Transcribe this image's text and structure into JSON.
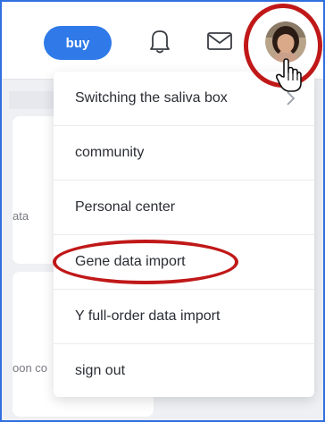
{
  "header": {
    "buy_label": "buy",
    "accent": "#2f7ae8"
  },
  "icons": {
    "notifications": "bell-icon",
    "messages": "mail-icon",
    "profile": "avatar",
    "pointer": "hand-cursor-icon",
    "submenu": "chevron-right-icon"
  },
  "background": {
    "card1_text": "ata",
    "card2_text": "oon co"
  },
  "menu": {
    "items": [
      {
        "label": "Switching the saliva box",
        "has_submenu": true
      },
      {
        "label": "community"
      },
      {
        "label": "Personal center"
      },
      {
        "label": "Gene data import"
      },
      {
        "label": "Y full-order data import"
      },
      {
        "label": "sign out"
      }
    ]
  },
  "highlight_color": "#c01818"
}
